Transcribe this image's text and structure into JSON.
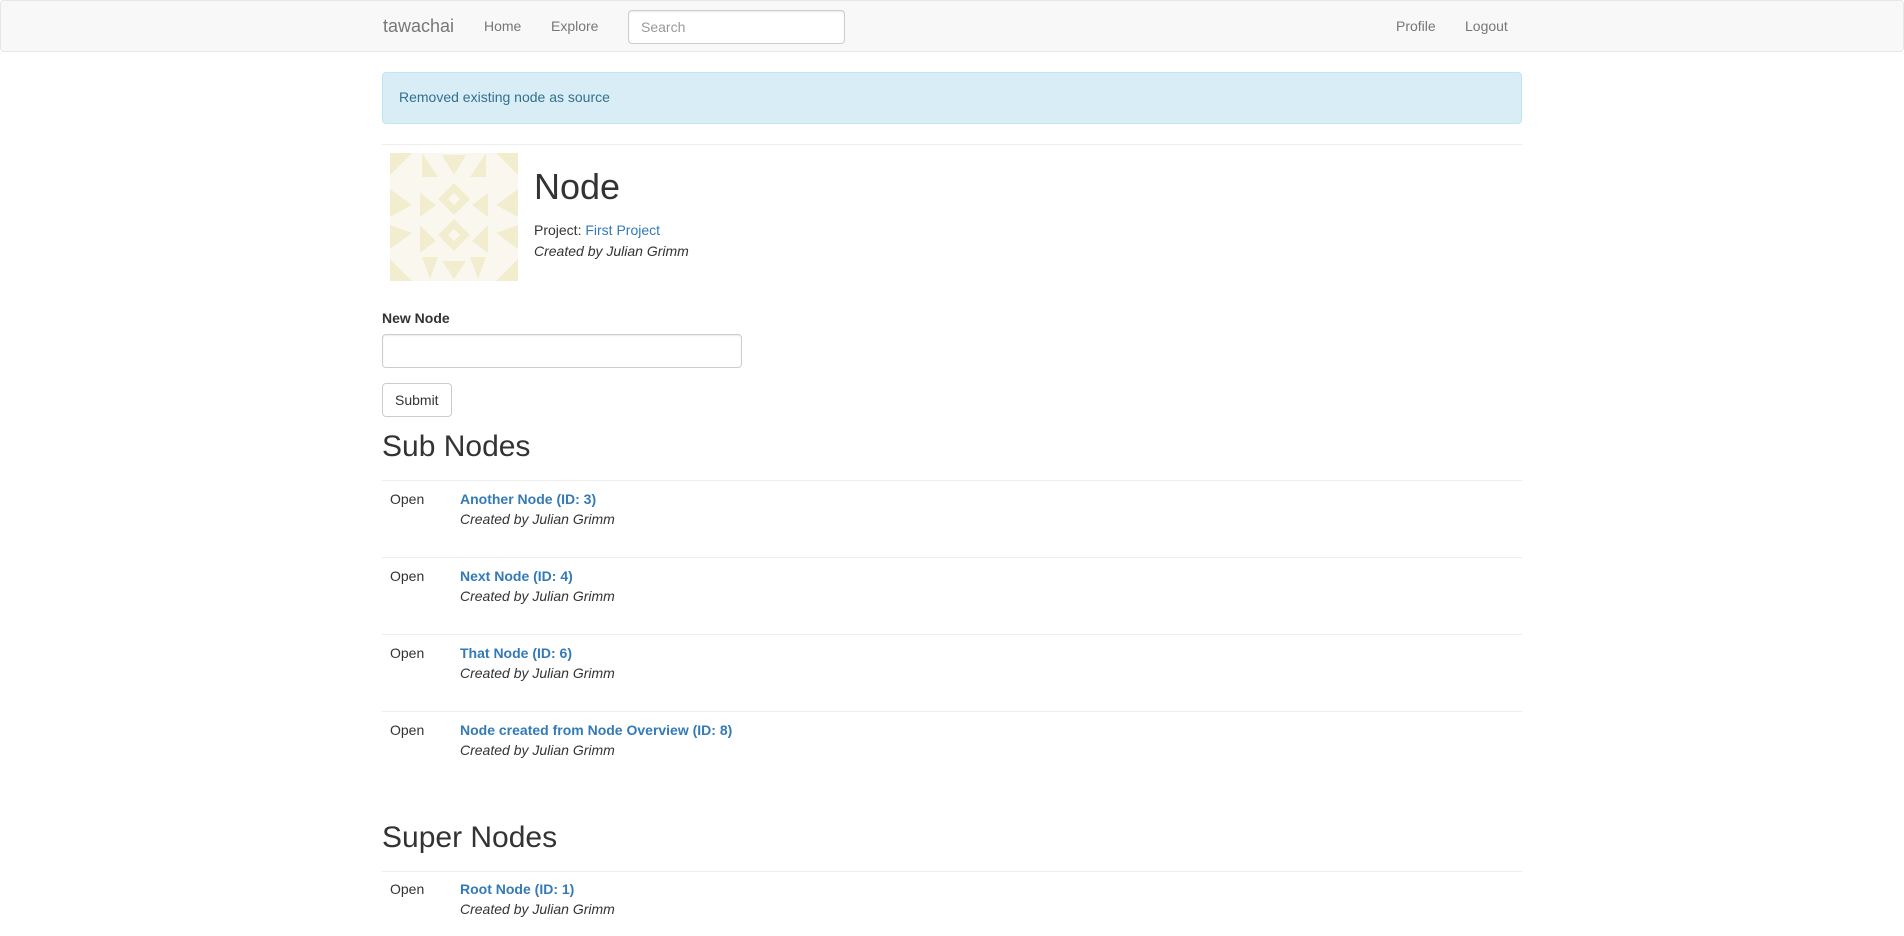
{
  "navbar": {
    "brand": "tawachai",
    "links": [
      "Home",
      "Explore"
    ],
    "search_placeholder": "Search",
    "right_links": [
      "Profile",
      "Logout"
    ]
  },
  "alert": {
    "text": "Removed existing node as source"
  },
  "node": {
    "title": "Node",
    "project_label": "Project:",
    "project_name": "First Project",
    "created_by": "Created by Julian Grimm"
  },
  "form": {
    "label": "New Node",
    "value": "",
    "submit_label": "Submit"
  },
  "sub_nodes": {
    "heading": "Sub Nodes",
    "items": [
      {
        "action": "Open",
        "title": "Another Node (ID: 3)",
        "created_by": "Created by Julian Grimm"
      },
      {
        "action": "Open",
        "title": "Next Node (ID: 4)",
        "created_by": "Created by Julian Grimm"
      },
      {
        "action": "Open",
        "title": "That Node (ID: 6)",
        "created_by": "Created by Julian Grimm"
      },
      {
        "action": "Open",
        "title": "Node created from Node Overview (ID: 8)",
        "created_by": "Created by Julian Grimm"
      }
    ]
  },
  "super_nodes": {
    "heading": "Super Nodes",
    "items": [
      {
        "action": "Open",
        "title": "Root Node (ID: 1)",
        "created_by": "Created by Julian Grimm"
      }
    ]
  },
  "colors": {
    "link": "#337ab7",
    "alert_bg": "#d9edf7",
    "alert_text": "#31708f",
    "identicon": "#f5f1dc"
  },
  "icons": {
    "identicon": "identicon-image"
  }
}
